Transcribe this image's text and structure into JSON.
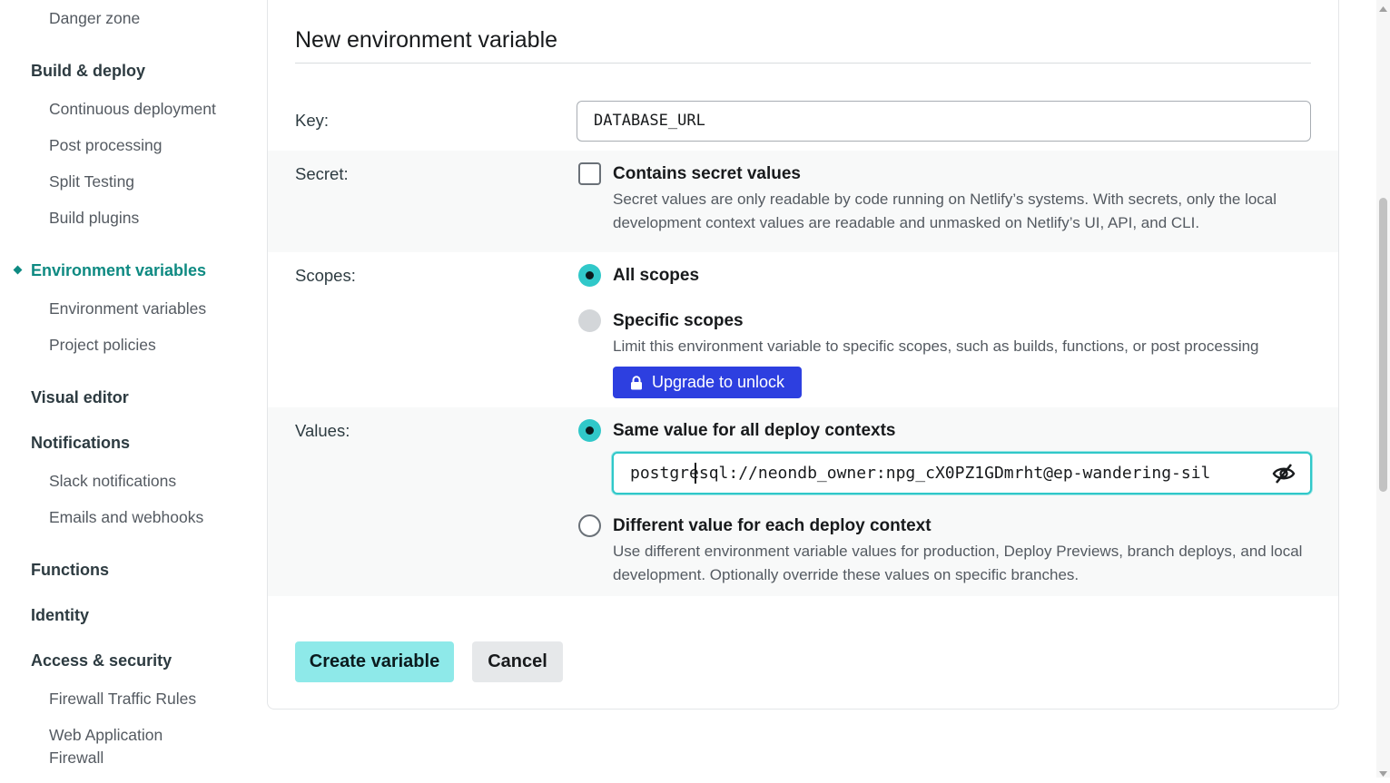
{
  "sidebar": {
    "items": [
      {
        "label": "Danger zone"
      },
      {
        "label": "Build & deploy"
      },
      {
        "label": "Continuous deployment"
      },
      {
        "label": "Post processing"
      },
      {
        "label": "Split Testing"
      },
      {
        "label": "Build plugins"
      },
      {
        "label": "Environment variables"
      },
      {
        "label": "Environment variables"
      },
      {
        "label": "Project policies"
      },
      {
        "label": "Visual editor"
      },
      {
        "label": "Notifications"
      },
      {
        "label": "Slack notifications"
      },
      {
        "label": "Emails and webhooks"
      },
      {
        "label": "Functions"
      },
      {
        "label": "Identity"
      },
      {
        "label": "Access & security"
      },
      {
        "label": "Firewall Traffic Rules"
      },
      {
        "label": "Web Application Firewall"
      }
    ],
    "active_label": "Environment variables"
  },
  "form": {
    "title": "New environment variable",
    "key": {
      "label": "Key:",
      "value": "DATABASE_URL"
    },
    "secret": {
      "label": "Secret:",
      "checkbox_label": "Contains secret values",
      "checked": false,
      "description": "Secret values are only readable by code running on Netlify’s systems. With secrets, only the local development context values are readable and unmasked on Netlify’s UI, API, and CLI."
    },
    "scopes": {
      "label": "Scopes:",
      "all_label": "All scopes",
      "specific_label": "Specific scopes",
      "specific_description": "Limit this environment variable to specific scopes, such as builds, functions, or post processing",
      "upgrade_label": "Upgrade to unlock"
    },
    "values": {
      "label": "Values:",
      "same_label": "Same value for all deploy contexts",
      "value": "postgresql://neondb_owner:npg_cX0PZ1GDmrht@ep-wandering-sil",
      "different_label": "Different value for each deploy context",
      "different_description": "Use different environment variable values for production, Deploy Previews, branch deploys, and local development. Optionally override these values on specific branches."
    },
    "create_label": "Create variable",
    "cancel_label": "Cancel"
  },
  "colors": {
    "accent": "#30c8c9",
    "active_nav": "#0e8a82",
    "upgrade_button": "#2d3fe0",
    "create_button": "#8ee9e9"
  },
  "icons": [
    "lock-icon",
    "eye-off-icon",
    "scroll-up-icon",
    "scroll-down-icon"
  ]
}
